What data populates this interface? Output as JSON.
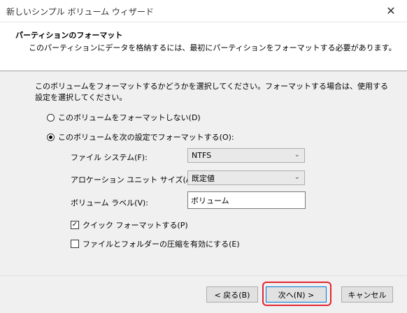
{
  "window": {
    "title": "新しいシンプル ボリューム ウィザード",
    "close_glyph": "✕"
  },
  "header": {
    "title": "パーティションのフォーマット",
    "subtitle": "このパーティションにデータを格納するには、最初にパーティションをフォーマットする必要があります。"
  },
  "instructions": "このボリュームをフォーマットするかどうかを選択してください。フォーマットする場合は、使用する設定を選択してください。",
  "options": {
    "no_format": {
      "label": "このボリュームをフォーマットしない(D)",
      "checked": false
    },
    "format": {
      "label": "このボリュームを次の設定でフォーマットする(O):",
      "checked": true
    }
  },
  "fields": {
    "file_system": {
      "label": "ファイル システム(F):",
      "value": "NTFS"
    },
    "allocation_unit": {
      "label": "アロケーション ユニット サイズ(A):",
      "value": "既定値"
    },
    "volume_label": {
      "label": "ボリューム ラベル(V):",
      "value": "ボリューム"
    }
  },
  "checkboxes": {
    "quick_format": {
      "label": "クイック フォーマットする(P)",
      "checked": true,
      "glyph": "✓"
    },
    "compression": {
      "label": "ファイルとフォルダーの圧縮を有効にする(E)",
      "checked": false
    }
  },
  "buttons": {
    "back": "< 戻る(B)",
    "next": "次へ(N) >",
    "cancel": "キャンセル"
  },
  "colors": {
    "highlight": "#e3252f",
    "focus": "#0078d7"
  }
}
